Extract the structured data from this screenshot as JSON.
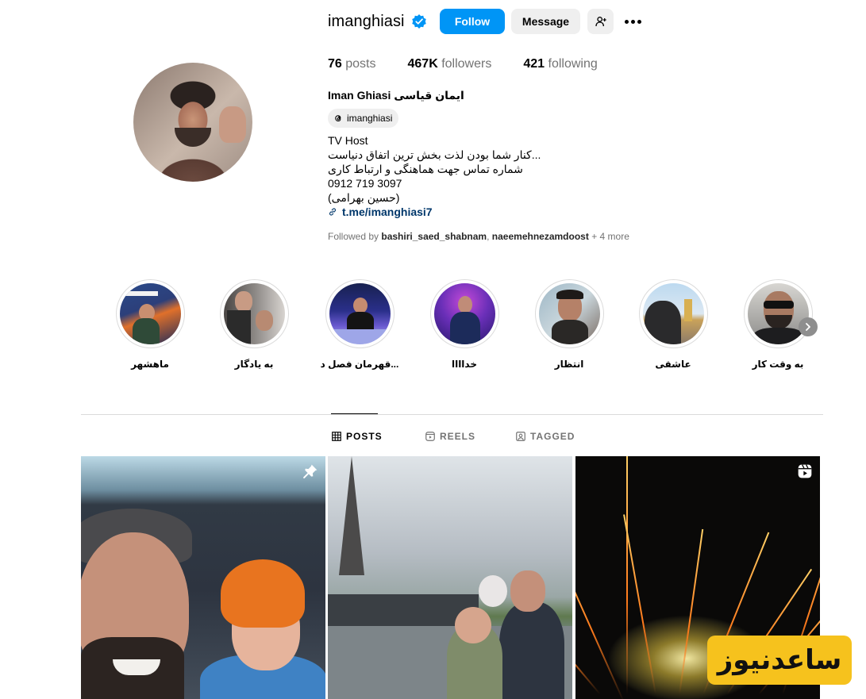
{
  "profile": {
    "username": "imanghiasi",
    "verified": true,
    "fullname": "Iman Ghiasi ایمان قیاسی",
    "threads_handle": "imanghiasi"
  },
  "actions": {
    "follow_label": "Follow",
    "message_label": "Message"
  },
  "stats": {
    "posts_count": "76",
    "posts_label": "posts",
    "followers_count": "467K",
    "followers_label": "followers",
    "following_count": "421",
    "following_label": "following"
  },
  "bio": {
    "line1": "TV Host",
    "line2": "کنار شما بودن لذت بخش ترین اتفاق دنیاست...",
    "line3": "شماره تماس جهت هماهنگی و ارتباط کاری",
    "line4": "0912 719 3097",
    "line5": "(حسین بهرامی)",
    "link": "t.me/imanghiasi7"
  },
  "followed_by": {
    "prefix": "Followed by",
    "user1": "bashiri_saed_shabnam",
    "separator": ",",
    "user2": "naeemehnezamdoost",
    "suffix": "+ 4 more"
  },
  "highlights": [
    {
      "label": "ماهشهر"
    },
    {
      "label": "به یادگار"
    },
    {
      "label": "قهرمان فصل د..."
    },
    {
      "label": "خداااا"
    },
    {
      "label": "انتظار"
    },
    {
      "label": "عاشقی"
    },
    {
      "label": "به وقت کار"
    }
  ],
  "tabs": {
    "posts": "POSTS",
    "reels": "REELS",
    "tagged": "TAGGED"
  },
  "watermark": {
    "text": "ساعدنیوز"
  },
  "colors": {
    "follow_blue": "#0095f6",
    "verified_blue": "#0095f6",
    "link_navy": "#00376b",
    "watermark_yellow": "#f6c21d"
  }
}
